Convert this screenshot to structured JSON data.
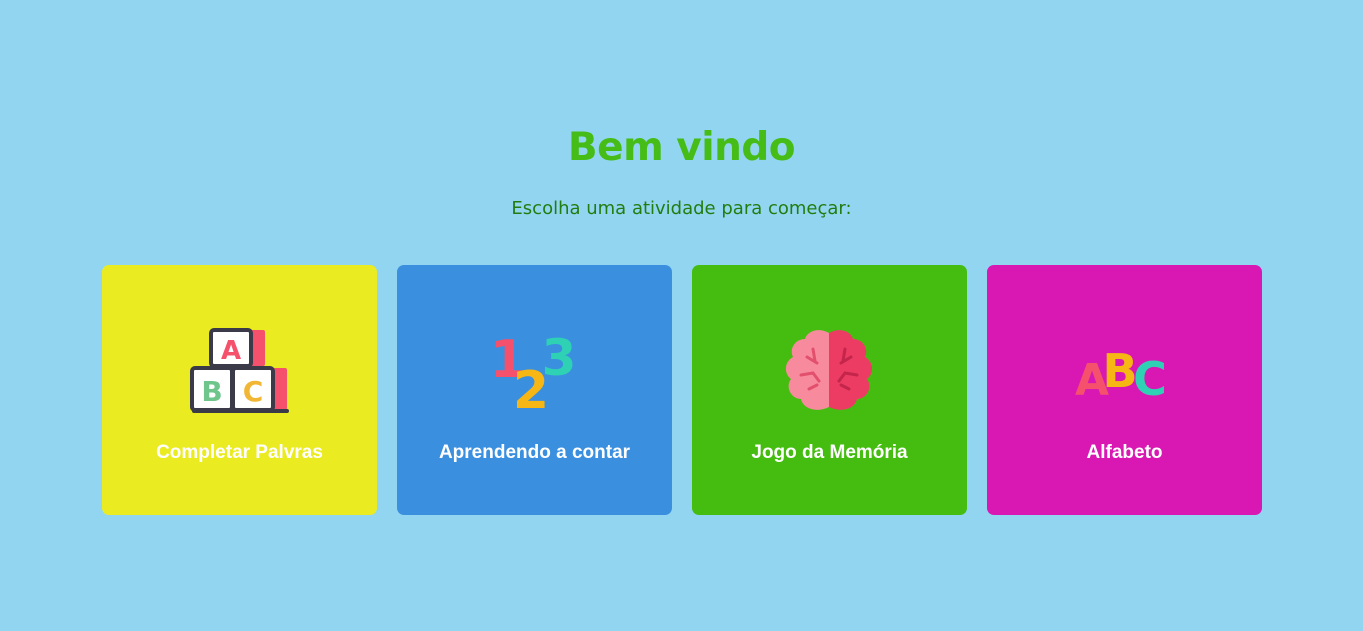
{
  "header": {
    "title": "Bem vindo",
    "subtitle": "Escolha uma atividade para começar:"
  },
  "colors": {
    "background": "#92d5f0",
    "title": "#45bd16",
    "subtitle": "#217d10"
  },
  "activities": [
    {
      "label": "Completar Palvras",
      "icon": "abc-blocks-icon",
      "color": "#ebeb21"
    },
    {
      "label": "Aprendendo a contar",
      "icon": "numbers-123-icon",
      "color": "#3b8fdf"
    },
    {
      "label": "Jogo da Memória",
      "icon": "brain-icon",
      "color": "#45bd10"
    },
    {
      "label": "Alfabeto",
      "icon": "abc-letters-icon",
      "color": "#d918b3"
    }
  ]
}
